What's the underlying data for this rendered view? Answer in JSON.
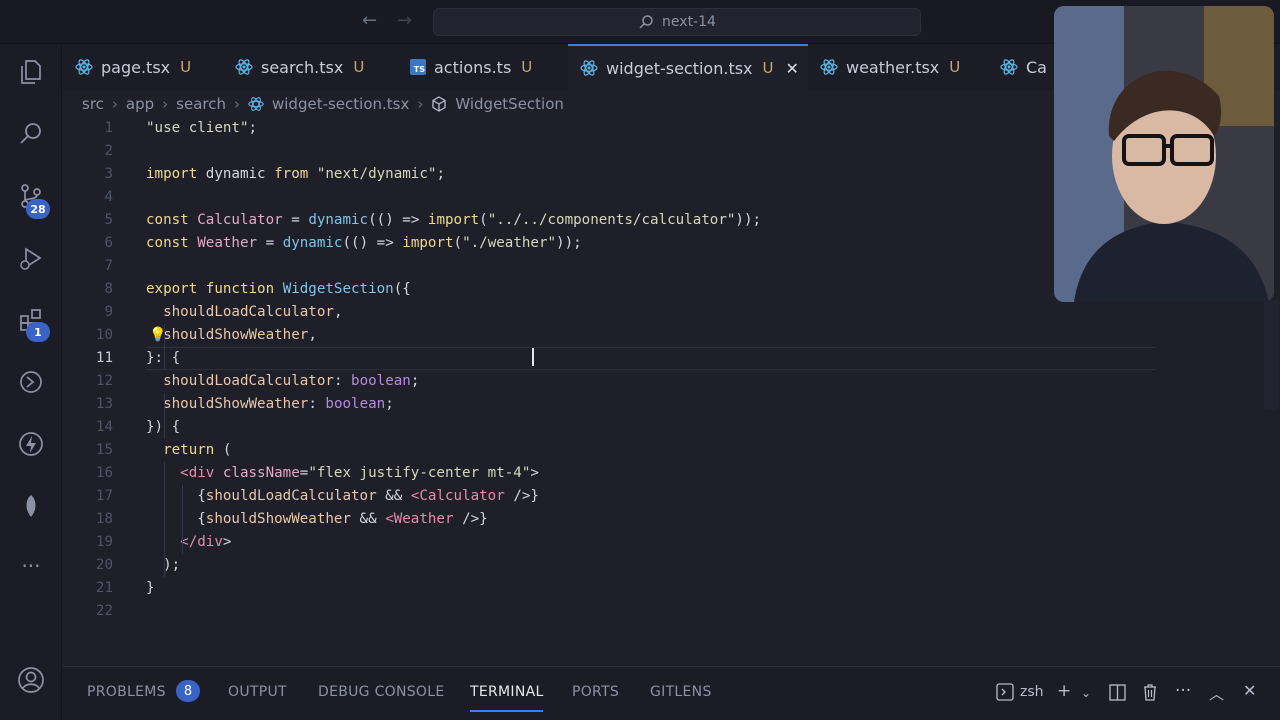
{
  "titlebar": {
    "search_text": "next-14"
  },
  "activity": {
    "scm_badge": "28",
    "extensions_badge": "1"
  },
  "tabs": [
    {
      "label": "page.tsx",
      "status": "U",
      "icon": "react-icon"
    },
    {
      "label": "search.tsx",
      "status": "U",
      "icon": "react-icon"
    },
    {
      "label": "actions.ts",
      "status": "U",
      "icon": "typescript-icon"
    },
    {
      "label": "widget-section.tsx",
      "status": "U",
      "icon": "react-icon",
      "active": true
    },
    {
      "label": "weather.tsx",
      "status": "U",
      "icon": "react-icon"
    },
    {
      "label": "Ca",
      "status": "",
      "icon": "react-icon"
    }
  ],
  "tab_close": "✕",
  "breadcrumb": [
    "src",
    "app",
    "search",
    "widget-section.tsx",
    "WidgetSection"
  ],
  "editor": {
    "active_line": 11,
    "line_numbers": [
      "1",
      "2",
      "3",
      "4",
      "5",
      "6",
      "7",
      "8",
      "9",
      "10",
      "11",
      "12",
      "13",
      "14",
      "15",
      "16",
      "17",
      "18",
      "19",
      "20",
      "21",
      "22"
    ],
    "lines": [
      "\"use client\";",
      "",
      "import dynamic from \"next/dynamic\";",
      "",
      "const Calculator = dynamic(() => import(\"../../components/calculator\"));",
      "const Weather = dynamic(() => import(\"./weather\"));",
      "",
      "export function WidgetSection({",
      "  shouldLoadCalculator,",
      "  shouldShowWeather,",
      "}: {",
      "  shouldLoadCalculator: boolean;",
      "  shouldShowWeather: boolean;",
      "}) {",
      "  return (",
      "    <div className=\"flex justify-center mt-4\">",
      "      {shouldLoadCalculator && <Calculator />}",
      "      {shouldShowWeather && <Weather />}",
      "    </div>",
      "  );",
      "}",
      ""
    ]
  },
  "panel": {
    "tabs": [
      "PROBLEMS",
      "OUTPUT",
      "DEBUG CONSOLE",
      "TERMINAL",
      "PORTS",
      "GITLENS"
    ],
    "active_tab": "TERMINAL",
    "problems_count": "8",
    "shell": "zsh"
  },
  "colors": {
    "accent": "#3d7ee8",
    "badge": "#3a63c8",
    "editor_bg": "#1e1f29"
  }
}
